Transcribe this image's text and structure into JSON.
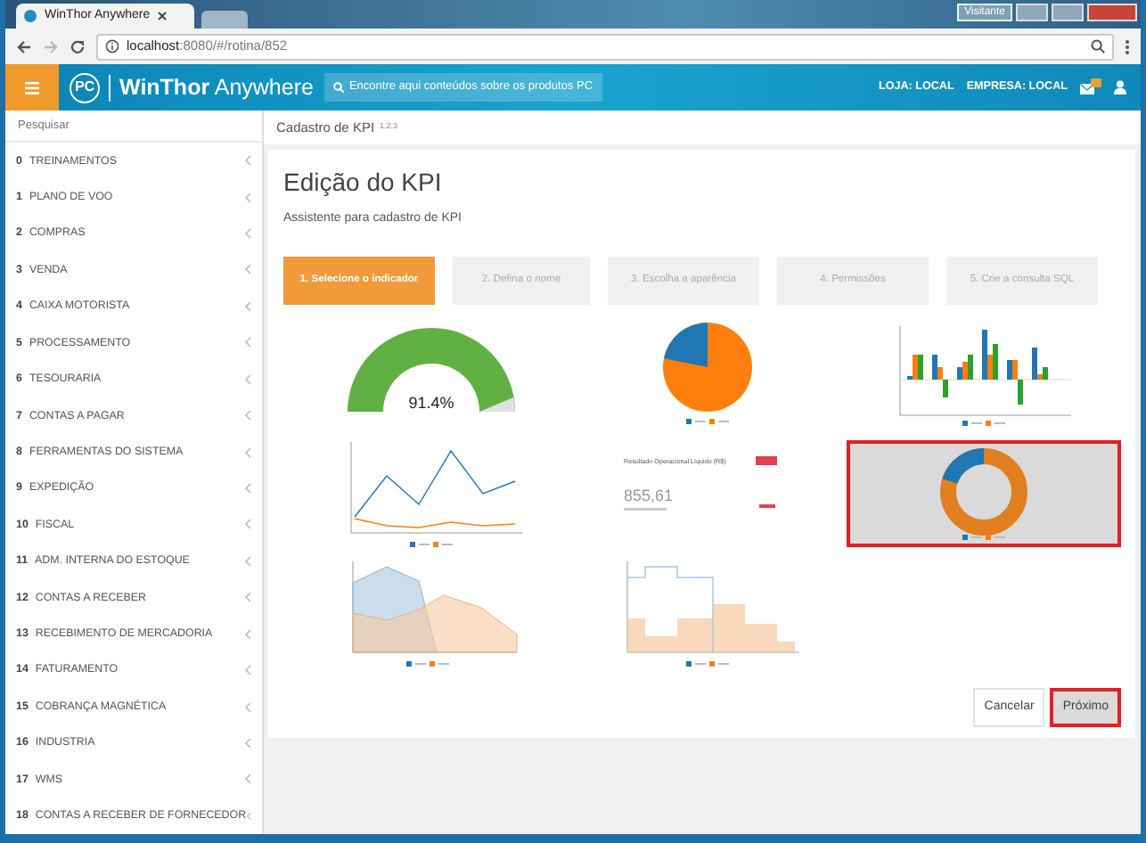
{
  "browser": {
    "tab_title": "WinThor Anywhere",
    "url_host": "localhost",
    "url_rest": ":8080/#/rotina/852",
    "profile": "Visitante"
  },
  "header": {
    "logo_mark": "PC",
    "brand": "WinThor",
    "brand_suffix": "Anywhere",
    "search_placeholder": "Encontre aqui conteúdos sobre os produtos PC",
    "store": "LOJA: LOCAL",
    "company": "EMPRESA: LOCAL"
  },
  "sidebar": {
    "search_placeholder": "Pesquisar",
    "items": [
      {
        "number": "0",
        "label": "TREINAMENTOS"
      },
      {
        "number": "1",
        "label": "PLANO DE VOO"
      },
      {
        "number": "2",
        "label": "COMPRAS"
      },
      {
        "number": "3",
        "label": "VENDA"
      },
      {
        "number": "4",
        "label": "CAIXA MOTORISTA"
      },
      {
        "number": "5",
        "label": "PROCESSAMENTO"
      },
      {
        "number": "6",
        "label": "TESOURARIA"
      },
      {
        "number": "7",
        "label": "CONTAS A PAGAR"
      },
      {
        "number": "8",
        "label": "FERRAMENTAS DO SISTEMA"
      },
      {
        "number": "9",
        "label": "EXPEDIÇÃO"
      },
      {
        "number": "10",
        "label": "FISCAL"
      },
      {
        "number": "11",
        "label": "ADM. INTERNA DO ESTOQUE"
      },
      {
        "number": "12",
        "label": "CONTAS A RECEBER"
      },
      {
        "number": "13",
        "label": "RECEBIMENTO DE MERCADORIA"
      },
      {
        "number": "14",
        "label": "FATURAMENTO"
      },
      {
        "number": "15",
        "label": "COBRANÇA MAGNÉTICA"
      },
      {
        "number": "16",
        "label": "INDUSTRIA"
      },
      {
        "number": "17",
        "label": "WMS"
      },
      {
        "number": "18",
        "label": "CONTAS A RECEBER DE FORNECEDOR"
      }
    ]
  },
  "breadcrumb": {
    "title": "Cadastro de KPI",
    "version": "1.2.3"
  },
  "wizard": {
    "title": "Edição do KPI",
    "subtitle": "Assistente para cadastro de KPI",
    "steps": [
      {
        "label": "1. Selecione o indicador",
        "selected": true
      },
      {
        "label": "2. Defina o nome",
        "selected": false
      },
      {
        "label": "3. Escolha a aparência",
        "selected": false
      },
      {
        "label": "4. Permissões",
        "selected": false
      },
      {
        "label": "5. Crie a consulta SQL",
        "selected": false
      }
    ],
    "options": [
      {
        "kind": "gauge",
        "selected": false,
        "value": "91.4%"
      },
      {
        "kind": "pie",
        "selected": false
      },
      {
        "kind": "bar",
        "selected": false
      },
      {
        "kind": "line",
        "selected": false
      },
      {
        "kind": "kpi",
        "selected": false,
        "title": "Resultado Operacional Líquido (R$)",
        "value": "855,61"
      },
      {
        "kind": "donut",
        "selected": true
      },
      {
        "kind": "area",
        "selected": false
      },
      {
        "kind": "step",
        "selected": false
      }
    ],
    "buttons": [
      {
        "label": "Cancelar",
        "highlighted": false
      },
      {
        "label": "Próximo",
        "highlighted": true
      }
    ]
  }
}
